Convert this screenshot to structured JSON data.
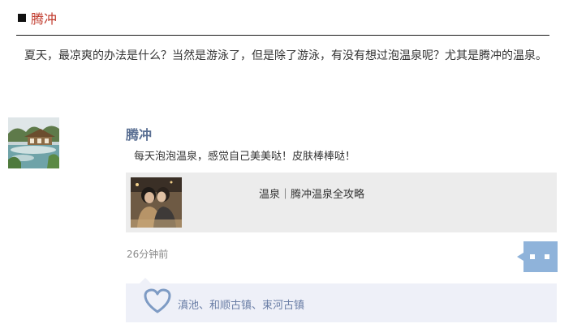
{
  "section": {
    "title": "腾冲"
  },
  "intro": {
    "text": "夏天，最凉爽的办法是什么？当然是游泳了，但是除了游泳，有没有想过泡温泉呢？尤其是腾冲的温泉。"
  },
  "post": {
    "username": "腾冲",
    "text": "每天泡泡温泉，感觉自己美美哒！皮肤棒棒哒！",
    "link": {
      "title": "温泉｜腾冲温泉全攻略"
    },
    "timestamp": "26分钟前"
  },
  "likes": {
    "text": "滇池、和顺古镇、束河古镇"
  },
  "colors": {
    "accent_red": "#c0392b",
    "name_blue": "#5a6f93",
    "comment_button_blue": "#8fb3da",
    "likes_bg": "#eef0f8",
    "card_bg": "#ececec"
  },
  "icons": {
    "section_marker": "square-icon",
    "comment": "comment-bubble-icon",
    "like": "heart-icon"
  }
}
